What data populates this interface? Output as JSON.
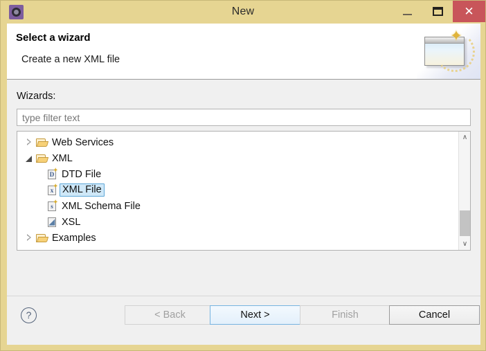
{
  "window": {
    "title": "New",
    "icon": "eclipse-gear-icon",
    "controls": {
      "minimize_label": "–",
      "maximize_label": "▭",
      "close_label": "✕"
    },
    "frame_color": "#e6d592",
    "close_color": "#c8555a"
  },
  "header": {
    "title": "Select a wizard",
    "subtitle": "Create a new XML file",
    "banner_icon": "new-wizard-banner-icon"
  },
  "main": {
    "wizards_label": "Wizards:",
    "filter": {
      "value": "",
      "placeholder": "type filter text"
    },
    "tree": [
      {
        "label": "Web Services",
        "type": "folder",
        "state": "collapsed",
        "level": 0,
        "selected": false,
        "icon": "folder-icon"
      },
      {
        "label": "XML",
        "type": "folder",
        "state": "expanded",
        "level": 0,
        "selected": false,
        "icon": "folder-icon"
      },
      {
        "label": "DTD File",
        "type": "file",
        "glyph": "D",
        "level": 1,
        "selected": false,
        "icon": "dtd-file-icon"
      },
      {
        "label": "XML File",
        "type": "file",
        "glyph": "x",
        "level": 1,
        "selected": true,
        "icon": "xml-file-icon"
      },
      {
        "label": "XML Schema File",
        "type": "file",
        "glyph": "s",
        "level": 1,
        "selected": false,
        "icon": "xml-schema-file-icon"
      },
      {
        "label": "XSL",
        "type": "file",
        "glyph": "◢",
        "level": 1,
        "selected": false,
        "icon": "xsl-file-icon"
      },
      {
        "label": "Examples",
        "type": "folder",
        "state": "collapsed",
        "level": 0,
        "selected": false,
        "icon": "folder-icon"
      }
    ],
    "scrollbar": {
      "up_arrow": "∧",
      "down_arrow": "∨"
    },
    "selection_color": "#cfe8f8",
    "selection_border_color": "#5ca7d8"
  },
  "footer": {
    "help_label": "?",
    "buttons": [
      {
        "label": "< Back",
        "name": "back-button",
        "state": "disabled"
      },
      {
        "label": "Next >",
        "name": "next-button",
        "state": "default"
      },
      {
        "label": "Finish",
        "name": "finish-button",
        "state": "disabled"
      },
      {
        "label": "Cancel",
        "name": "cancel-button",
        "state": "enabled"
      }
    ]
  }
}
